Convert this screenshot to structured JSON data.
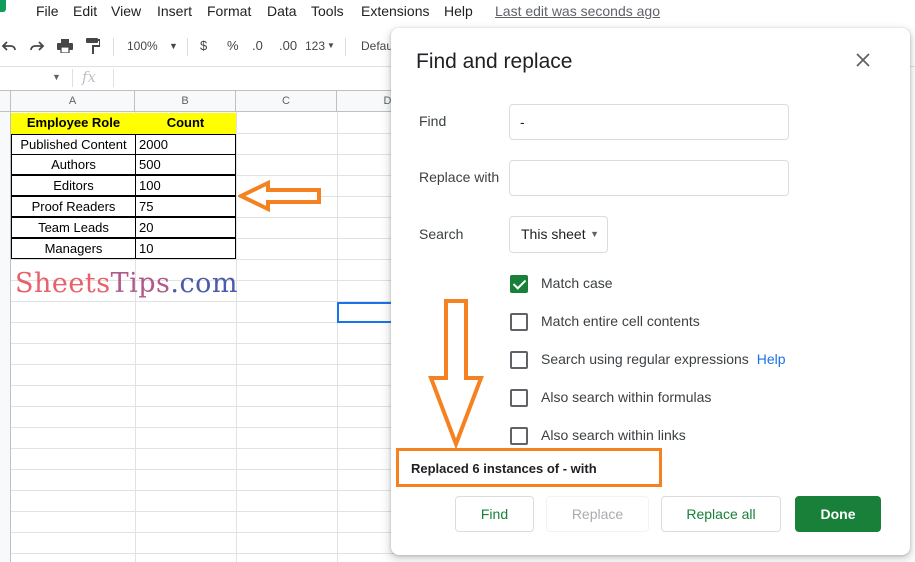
{
  "menu": {
    "items": [
      "File",
      "Edit",
      "View",
      "Insert",
      "Format",
      "Data",
      "Tools",
      "Extensions",
      "Help"
    ],
    "last_edit": "Last edit was seconds ago"
  },
  "toolbar": {
    "zoom": "100%",
    "currency": "$",
    "percent": "%",
    "decrease_decimal": ".0",
    "increase_decimal": ".00",
    "more_formats": "123",
    "font": "Defau"
  },
  "formula_bar": {
    "fx": "fx"
  },
  "grid": {
    "column_headers": [
      "A",
      "B",
      "C",
      "D"
    ],
    "table_header": {
      "role": "Employee Role",
      "count": "Count"
    },
    "rows": [
      {
        "role": "Published Content",
        "count": "2000"
      },
      {
        "role": "Authors",
        "count": "500"
      },
      {
        "role": "Editors",
        "count": "100"
      },
      {
        "role": "Proof Readers",
        "count": "75"
      },
      {
        "role": "Team Leads",
        "count": "20"
      },
      {
        "role": "Managers",
        "count": "10"
      }
    ]
  },
  "watermark": {
    "part1": "Sheets",
    "part2": "Tips",
    "part3": ".com"
  },
  "dialog": {
    "title": "Find and replace",
    "find_label": "Find",
    "find_value": "-",
    "replace_label": "Replace with",
    "replace_value": "",
    "search_label": "Search",
    "search_value": "This sheet",
    "options": [
      {
        "label": "Match case",
        "checked": true
      },
      {
        "label": "Match entire cell contents",
        "checked": false
      },
      {
        "label": "Search using regular expressions",
        "checked": false
      },
      {
        "label": "Also search within formulas",
        "checked": false
      },
      {
        "label": "Also search within links",
        "checked": false
      }
    ],
    "help_link": "Help",
    "status": "Replaced 6 instances of - with",
    "buttons": {
      "find": "Find",
      "replace": "Replace",
      "replace_all": "Replace all",
      "done": "Done"
    }
  },
  "colors": {
    "accent_green": "#188038",
    "annotation_orange": "#f58220",
    "header_yellow": "#ffff00",
    "link_blue": "#1a73e8"
  }
}
